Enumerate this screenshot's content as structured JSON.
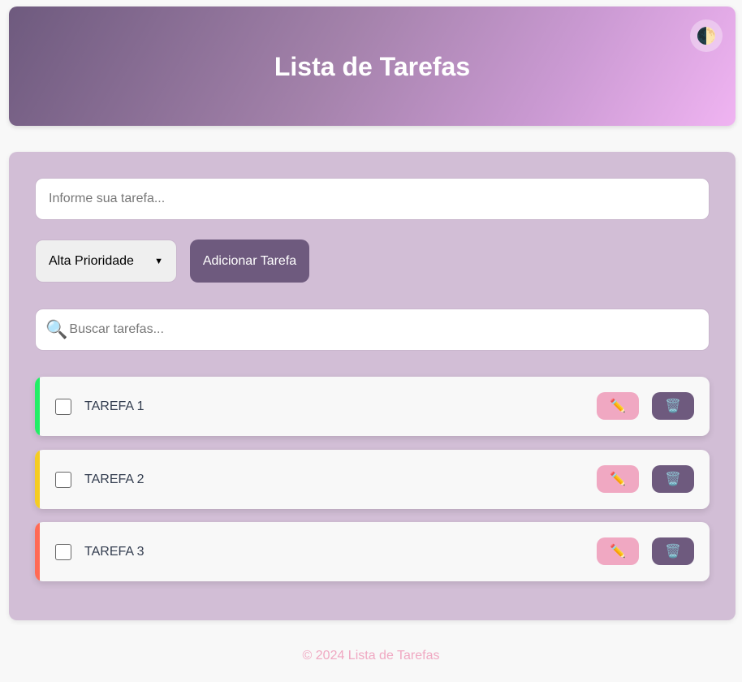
{
  "header": {
    "title": "Lista de Tarefas",
    "theme_toggle_icon": "🌓"
  },
  "form": {
    "task_placeholder": "Informe sua tarefa...",
    "task_value": "",
    "priority_selected": "Alta Prioridade",
    "add_button_label": "Adicionar Tarefa",
    "search_icon": "🔍",
    "search_placeholder": "Buscar tarefas...",
    "search_value": ""
  },
  "tasks": [
    {
      "label": "TAREFA 1",
      "priority_color": "#22ee66",
      "checked": false
    },
    {
      "label": "TAREFA 2",
      "priority_color": "#f5cc22",
      "checked": false
    },
    {
      "label": "TAREFA 3",
      "priority_color": "#ff6a55",
      "checked": false
    }
  ],
  "task_actions": {
    "edit_icon": "✏️",
    "delete_icon": "🗑️"
  },
  "footer": {
    "text": "© 2024 Lista de Tarefas"
  },
  "colors": {
    "accent": "#6e5a7e",
    "panel": "#d2bed6",
    "edit_button": "#f0a8c2",
    "footer_text": "#f0a8c2"
  }
}
